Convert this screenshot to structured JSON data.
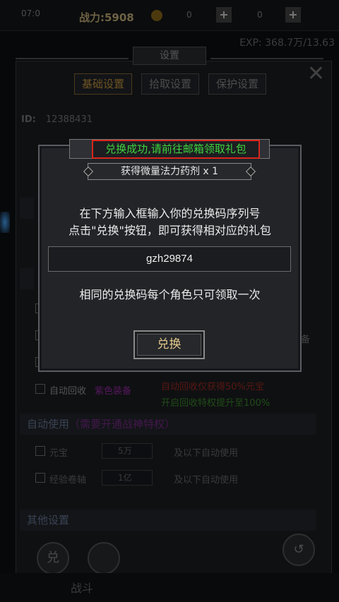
{
  "topbar": {
    "time": "07:0",
    "power": "战力:5908",
    "val1": "0",
    "val2": "0",
    "plus": "+",
    "exp": "EXP: 368.7万/13.63"
  },
  "settings": {
    "title": "设置",
    "close": "✕",
    "tabs": [
      "基础设置",
      "拾取设置",
      "保护设置"
    ],
    "id_label": "ID:",
    "id_value": "12388431",
    "auto_recycle_label": "自动回收",
    "auto_recycle_value": "紫色装备",
    "recycle_note1": "自动回收仅获得50%元宝",
    "recycle_note2": "开启回收特权提升至100%",
    "auto_use_header": "自动使用",
    "auto_use_note": "（需要开通战神特权）",
    "row1_label": "元宝",
    "row1_value": "5万",
    "row1_suffix": "及以下自动使用",
    "row2_label": "经验卷轴",
    "row2_value": "1亿",
    "row2_suffix": "及以下自动使用",
    "other_header": "其他设置",
    "side_char": "备",
    "redeem_icon_char": "兑",
    "back_icon": "↺"
  },
  "bottom_nav": [
    "战斗"
  ],
  "dialog": {
    "toast": "兑换成功,请前往邮箱领取礼包",
    "reward": "获得微量法力药剂 x 1",
    "instruction_line1": "在下方输入框输入你的兑换码序列号",
    "instruction_line2": "点击\"兑换\"按钮，即可获得相对应的礼包",
    "code_value": "gzh29874",
    "note": "相同的兑换码每个角色只可领取一次",
    "button_label": "兑换"
  },
  "colors": {
    "toast_text": "#3fd33f",
    "toast_border": "#d9261c",
    "button_text": "#e4c98a",
    "active_tab": "#c89a40"
  }
}
